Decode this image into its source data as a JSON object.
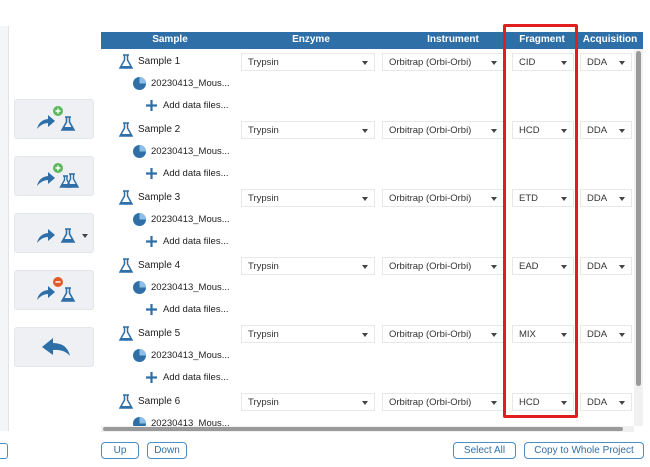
{
  "columns": [
    "Sample",
    "Enzyme",
    "Instrument",
    "Fragment",
    "Acquisition"
  ],
  "samples": [
    {
      "name": "Sample 1",
      "enzyme": "Trypsin",
      "instrument": "Orbitrap (Orbi-Orbi)",
      "fragment": "CID",
      "acquisition": "DDA",
      "file": "20230413_Mous...",
      "add": "Add data files..."
    },
    {
      "name": "Sample 2",
      "enzyme": "Trypsin",
      "instrument": "Orbitrap (Orbi-Orbi)",
      "fragment": "HCD",
      "acquisition": "DDA",
      "file": "20230413_Mous...",
      "add": "Add data files..."
    },
    {
      "name": "Sample 3",
      "enzyme": "Trypsin",
      "instrument": "Orbitrap (Orbi-Orbi)",
      "fragment": "ETD",
      "acquisition": "DDA",
      "file": "20230413_Mous...",
      "add": "Add data files..."
    },
    {
      "name": "Sample 4",
      "enzyme": "Trypsin",
      "instrument": "Orbitrap (Orbi-Orbi)",
      "fragment": "EAD",
      "acquisition": "DDA",
      "file": "20230413_Mous...",
      "add": "Add data files..."
    },
    {
      "name": "Sample 5",
      "enzyme": "Trypsin",
      "instrument": "Orbitrap (Orbi-Orbi)",
      "fragment": "MIX",
      "acquisition": "DDA",
      "file": "20230413_Mous...",
      "add": "Add data files..."
    },
    {
      "name": "Sample 6",
      "enzyme": "Trypsin",
      "instrument": "Orbitrap (Orbi-Orbi)",
      "fragment": "HCD",
      "acquisition": "DDA",
      "file": "20230413_Mous..."
    }
  ],
  "buttons": {
    "up": "Up",
    "down": "Down",
    "select_all": "Select All",
    "copy": "Copy to Whole Project"
  },
  "colors": {
    "header": "#2f6fa7",
    "highlight": "#e01e1e",
    "accent": "#4d8fc7",
    "flask": "#2f6fa7",
    "add_badge": "#5cb85c",
    "remove_badge": "#e05a2b"
  }
}
